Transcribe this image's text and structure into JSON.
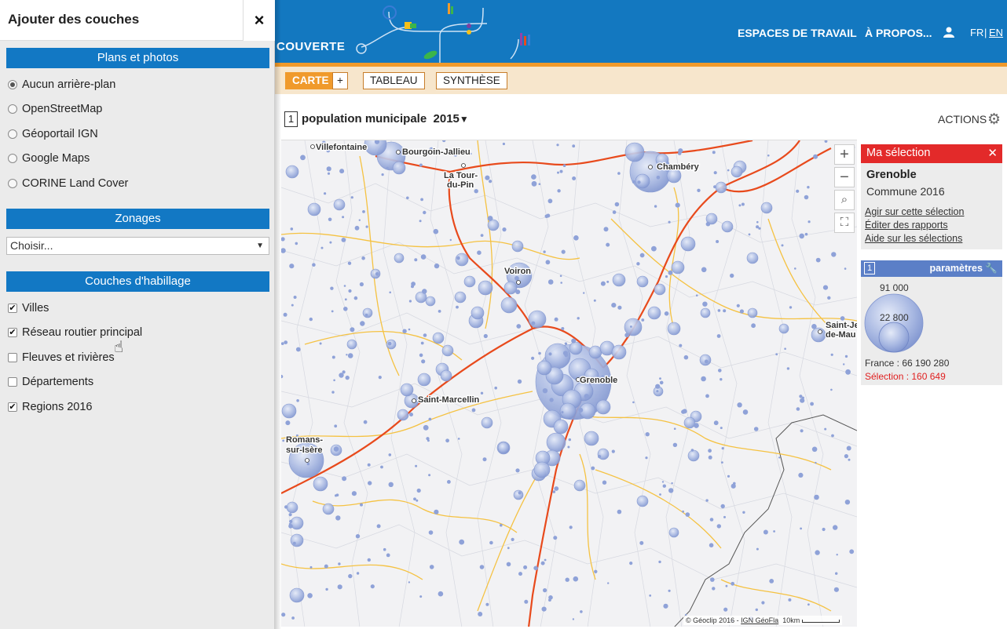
{
  "left_panel": {
    "title": "Ajouter des couches",
    "close": "×",
    "plans_title": "Plans et photos",
    "basemaps": [
      {
        "label": "Aucun arrière-plan",
        "selected": true
      },
      {
        "label": "OpenStreetMap",
        "selected": false
      },
      {
        "label": "Géoportail IGN",
        "selected": false
      },
      {
        "label": "Google Maps",
        "selected": false
      },
      {
        "label": "CORINE Land Cover",
        "selected": false
      }
    ],
    "zonages_title": "Zonages",
    "zonages_select": "Choisir...",
    "habillage_title": "Couches d'habillage",
    "layers": [
      {
        "label": "Villes",
        "checked": true
      },
      {
        "label": "Réseau routier principal",
        "checked": true
      },
      {
        "label": "Fleuves et rivières",
        "checked": false
      },
      {
        "label": "Départements",
        "checked": false
      },
      {
        "label": "Regions 2016",
        "checked": true
      }
    ]
  },
  "header": {
    "brand": "COUVERTE",
    "nav": [
      "ESPACES DE TRAVAIL",
      "À PROPOS..."
    ],
    "lang_fr": "FR",
    "lang_sep": "|",
    "lang_en": "EN"
  },
  "tabs": {
    "carte": "CARTE",
    "plus": "+",
    "tableau": "TABLEAU",
    "synthese": "SYNTHÈSE"
  },
  "indicator": {
    "number": "1",
    "title": "population municipale",
    "year": "2015"
  },
  "actions_label": "ACTIONS",
  "map": {
    "zoom_in": "+",
    "zoom_out": "−",
    "cities": [
      {
        "name": "Villefontaine"
      },
      {
        "name": "Bourgoin-Jallieu"
      },
      {
        "name": "La Tour-"
      },
      {
        "name": "du-Pin"
      },
      {
        "name": "Chambéry"
      },
      {
        "name": "Voiron"
      },
      {
        "name": "Saint-Je"
      },
      {
        "name": "de-Mau"
      },
      {
        "name": "Grenoble"
      },
      {
        "name": "Saint-Marcellin"
      },
      {
        "name": "Romans-"
      },
      {
        "name": "sur-Isère"
      }
    ],
    "attribution": "© Géoclip 2016 - ",
    "attribution_link": "IGN GéoFla",
    "scale": "10km"
  },
  "selection": {
    "header": "Ma sélection",
    "close": "✕",
    "name": "Grenoble",
    "subtitle": "Commune 2016",
    "links": [
      "Agir sur cette sélection",
      "Éditer des rapports",
      "Aide sur les sélections"
    ]
  },
  "legend": {
    "number": "1",
    "params": "paramètres",
    "value_large": "91 000",
    "value_small": "22 800",
    "france": "France : 66 190 280",
    "selection": "Sélection : 160 649"
  },
  "colors": {
    "primary": "#1378c0",
    "accent": "#f09a2b",
    "selection_red": "#e32a2a",
    "bubble": "#9fb0dd",
    "road_main": "#e84a1c",
    "road_secondary": "#f5c242"
  }
}
